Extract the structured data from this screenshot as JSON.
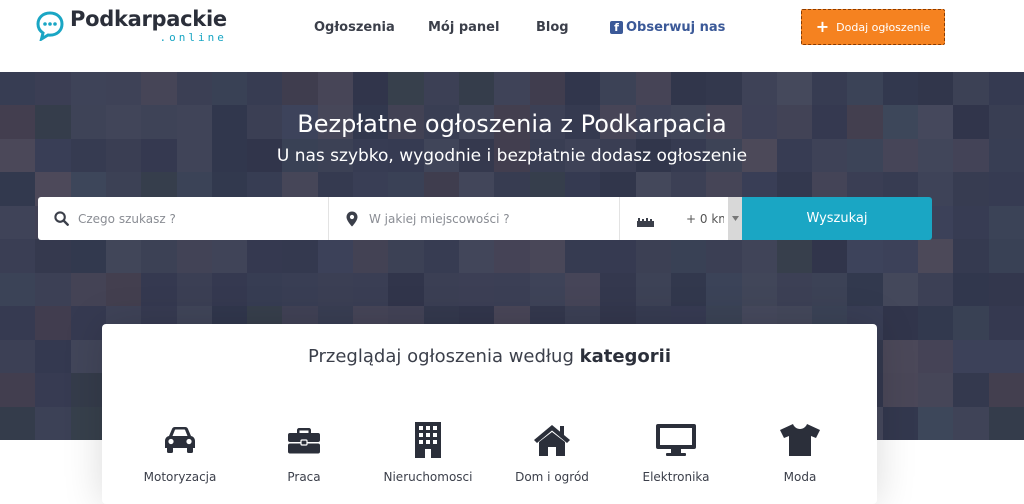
{
  "logo": {
    "name": "Podkarpackie",
    "suffix": ".online"
  },
  "nav": [
    {
      "label": "Ogłoszenia"
    },
    {
      "label": "Mój panel"
    },
    {
      "label": "Blog"
    },
    {
      "label": "Obserwuj nas",
      "icon": "facebook-icon"
    }
  ],
  "header": {
    "add_button_label": "Dodaj ogłoszenie"
  },
  "hero": {
    "title": "Bezpłatne ogłoszenia z Podkarpacia",
    "subtitle": "U nas szybko, wygodnie i bezpłatnie dodasz ogłoszenie"
  },
  "search": {
    "what_placeholder": "Czego szukasz ?",
    "where_placeholder": "W jakiej miejscowości ?",
    "distance_value": "+ 0 km",
    "button_label": "Wyszukaj"
  },
  "categories": {
    "title_prefix": "Przeglądaj ogłoszenia według",
    "title_bold": "kategorii",
    "items": [
      {
        "label": "Motoryzacja",
        "icon": "car-icon"
      },
      {
        "label": "Praca",
        "icon": "briefcase-icon"
      },
      {
        "label": "Nieruchomosci",
        "icon": "building-icon"
      },
      {
        "label": "Dom i ogród",
        "icon": "house-icon"
      },
      {
        "label": "Elektronika",
        "icon": "monitor-icon"
      },
      {
        "label": "Moda",
        "icon": "tshirt-icon"
      }
    ]
  },
  "colors": {
    "accent": "#f58220",
    "brand": "#1aa6c4",
    "facebook": "#3b5998",
    "text_dark": "#2b2f3a"
  }
}
